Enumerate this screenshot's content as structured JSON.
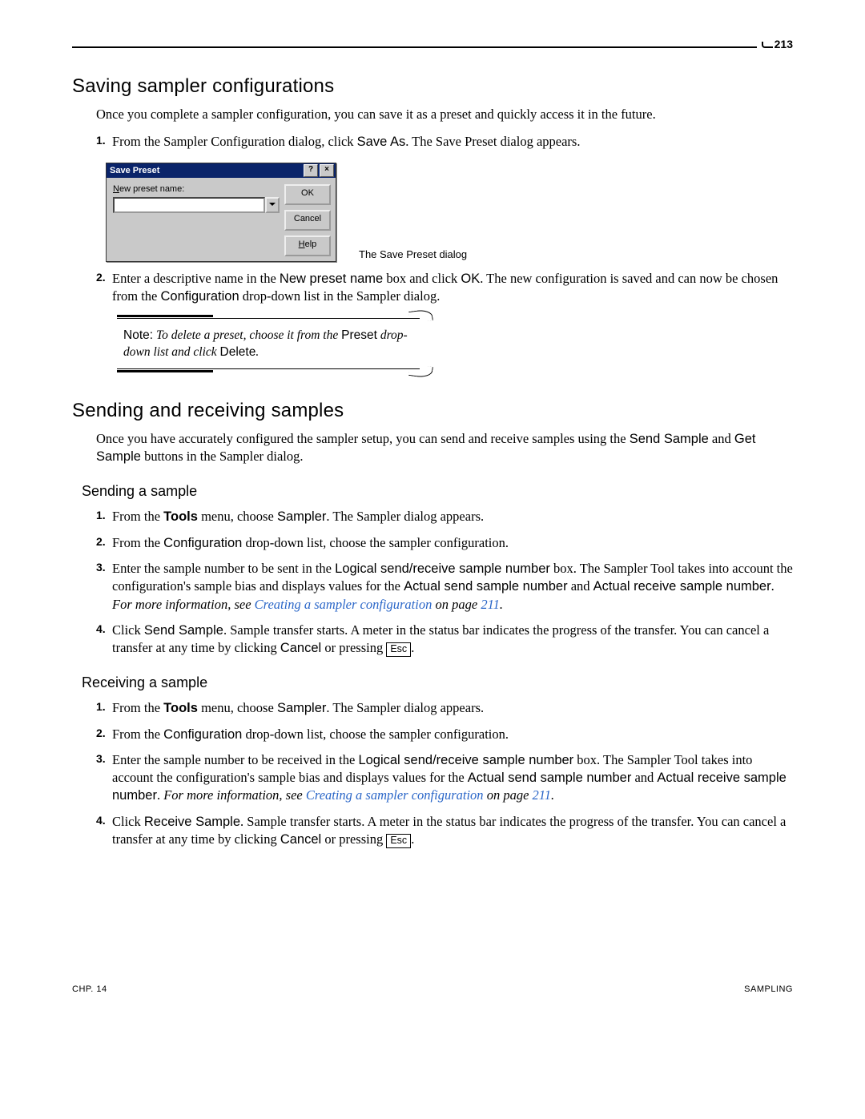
{
  "page_number": "213",
  "section1": {
    "heading": "Saving sampler configurations",
    "intro": "Once you complete a sampler configuration, you can save it as a preset and quickly access it in the future.",
    "steps": {
      "s1_a": "From the Sampler Configuration dialog, click ",
      "s1_b": "Save As",
      "s1_c": ". The Save Preset dialog appears.",
      "s2_a": "Enter a descriptive name in the ",
      "s2_b": "New preset name",
      "s2_c": " box and click ",
      "s2_d": "OK",
      "s2_e": ". The new configuration is saved and can now be chosen from the ",
      "s2_f": "Configuration",
      "s2_g": " drop-down list in the Sampler dialog."
    }
  },
  "dialog": {
    "title": "Save Preset",
    "help_glyph": "?",
    "close_glyph": "×",
    "label_prefix_ul": "N",
    "label_rest": "ew preset name:",
    "btn_ok": "OK",
    "btn_cancel": "Cancel",
    "btn_help_ul": "H",
    "btn_help_rest": "elp",
    "caption": "The Save Preset dialog"
  },
  "note": {
    "label": "Note:",
    "pre": " To delete a preset, choose it from the ",
    "sans1": "Preset",
    "mid": " drop-down list and click ",
    "sans2": "Delete",
    "post": "."
  },
  "section2": {
    "heading": "Sending and receiving samples",
    "intro_a": "Once you have accurately configured the sampler setup, you can send and receive samples using the ",
    "intro_b": "Send Sample",
    "intro_c": " and ",
    "intro_d": "Get Sample",
    "intro_e": " buttons in the Sampler dialog."
  },
  "sending": {
    "heading": "Sending a sample",
    "s1_a": "From the ",
    "s1_b": "Tools",
    "s1_c": " menu, choose ",
    "s1_d": "Sampler",
    "s1_e": ". The Sampler dialog appears.",
    "s2_a": "From the ",
    "s2_b": "Configuration",
    "s2_c": " drop-down list, choose the sampler configuration.",
    "s3_a": "Enter the sample number to be sent in the ",
    "s3_b": "Logical send/receive sample number",
    "s3_c": " box. The Sampler Tool takes into account the configuration's sample bias and displays values for the ",
    "s3_d": "Actual send sample number",
    "s3_e": " and ",
    "s3_f": "Actual receive sample number",
    "s3_g": ". ",
    "s3_h": "For more information, see ",
    "s3_link": "Creating a sampler configuration",
    "s3_i": " on page ",
    "s3_linkpage": "211",
    "s3_j": ".",
    "s4_a": "Click ",
    "s4_b": "Send Sample",
    "s4_c": ". Sample transfer starts. A meter in the status bar indicates the progress of the transfer. You can cancel a transfer at any time by clicking ",
    "s4_d": "Cancel",
    "s4_e": " or pressing ",
    "s4_key": "Esc",
    "s4_f": "."
  },
  "receiving": {
    "heading": "Receiving a sample",
    "s1_a": "From the ",
    "s1_b": "Tools",
    "s1_c": " menu, choose ",
    "s1_d": "Sampler",
    "s1_e": ". The Sampler dialog appears.",
    "s2_a": "From the ",
    "s2_b": "Configuration",
    "s2_c": " drop-down list, choose the sampler configuration.",
    "s3_a": "Enter the sample number to be received in the ",
    "s3_b": "Logical send/receive sample number",
    "s3_c": " box. The Sampler Tool takes into account the configuration's sample bias and displays values for the ",
    "s3_d": "Actual send sample number",
    "s3_e": " and ",
    "s3_f": "Actual receive sample number",
    "s3_g": ". ",
    "s3_h": "For more information, see ",
    "s3_link": "Creating a sampler configuration",
    "s3_i": " on page ",
    "s3_linkpage": "211",
    "s3_j": ".",
    "s4_a": "Click ",
    "s4_b": "Receive Sample",
    "s4_c": ". Sample transfer starts. A meter in the status bar indicates the progress of the transfer. You can cancel a transfer at any time by clicking ",
    "s4_d": "Cancel",
    "s4_e": " or pressing ",
    "s4_key": "Esc",
    "s4_f": "."
  },
  "footer": {
    "left": "CHP. 14",
    "right": "SAMPLING"
  }
}
